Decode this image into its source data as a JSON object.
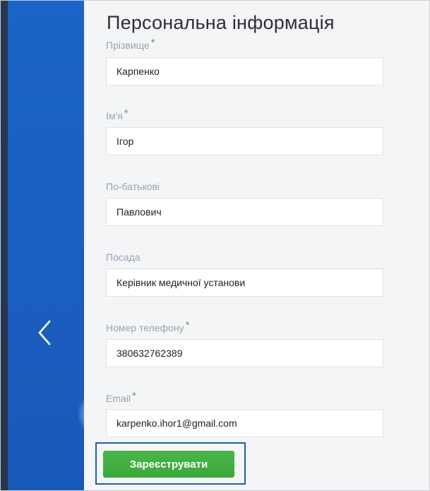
{
  "form": {
    "title": "Персональна інформація",
    "required_mark": "*",
    "fields": [
      {
        "label": "Прізвище",
        "value": "Карпенко",
        "required": true
      },
      {
        "label": "Ім'я",
        "value": "Ігор",
        "required": true
      },
      {
        "label": "По-батькові",
        "value": "Павлович",
        "required": false
      },
      {
        "label": "Посада",
        "value": "Керівник медичної установи",
        "required": false
      },
      {
        "label": "Номер телефону",
        "value": "380632762389",
        "required": true
      },
      {
        "label": "Email",
        "value": "karpenko.ihor1@gmail.com",
        "required": true
      }
    ],
    "submit_label": "Зареєструвати"
  },
  "nav": {
    "back_icon": "chevron-left-icon"
  },
  "colors": {
    "side_panel": "#1a5fc1",
    "required": "#4caf50",
    "submit_button": "#3fae3e",
    "highlight_border": "#1f5fa8",
    "label": "#9aa2b1"
  }
}
